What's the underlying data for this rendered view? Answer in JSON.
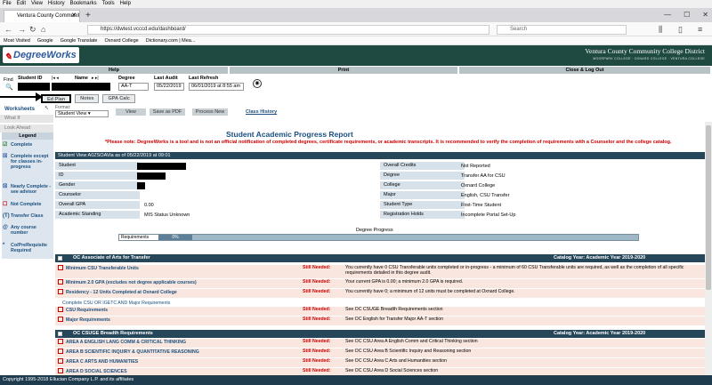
{
  "browser": {
    "menu": [
      "File",
      "Edit",
      "View",
      "History",
      "Bookmarks",
      "Tools",
      "Help"
    ],
    "tab_title": "Ventura County Community C",
    "url": "https://dwtest.vcccd.edu/dashboard/",
    "search_placeholder": "Search",
    "bookmarks": [
      "Most Visited",
      "Google",
      "Google Translate",
      "Oxnard College",
      "Dictionary.com | Mea..."
    ]
  },
  "header": {
    "logo": "DegreeWorks",
    "college": "Ventura County Community College District",
    "college_sub": "MOORPARK COLLEGE · OXNARD COLLEGE · VENTURA COLLEGE",
    "nav": [
      "Help",
      "Print",
      "Close & Log Out"
    ]
  },
  "student_bar": {
    "find": "Find",
    "student_id_lbl": "Student ID",
    "name_lbl": "Name",
    "degree_lbl": "Degree",
    "degree_val": "AA-T",
    "last_audit_lbl": "Last Audit",
    "last_audit_val": "05/22/2019",
    "last_refresh_lbl": "Last Refresh",
    "last_refresh_val": "06/01/2019 at 8:55 am"
  },
  "tabs": [
    "Ed Plan",
    "Notes",
    "GPA Calc"
  ],
  "worksheets": "Worksheets",
  "format_lbl": "Format:",
  "format_val": "Student View",
  "buttons": [
    "View",
    "Save as PDF",
    "Process New"
  ],
  "class_history": "Class History",
  "sidebar": {
    "what_if": "What If",
    "look_ahead": "Look Ahead",
    "legend_title": "Legend",
    "legend": [
      {
        "icon": "☑",
        "label": "Complete",
        "color": "#2a8a2a"
      },
      {
        "icon": "☒",
        "label": "Complete except for classes in-progress",
        "color": "#2c5aa0"
      },
      {
        "icon": "☒",
        "label": "Nearly Complete - see advisor",
        "color": "#2c5aa0"
      },
      {
        "icon": "☐",
        "label": "Not Complete",
        "color": "#c00"
      },
      {
        "icon": "(T)",
        "label": "Transfer Class",
        "color": "#1a4f7f"
      },
      {
        "icon": "@",
        "label": "Any course number",
        "color": "#1a4f7f"
      },
      {
        "icon": "*",
        "label": "Co/PreRequisite Required",
        "color": "#1a4f7f"
      }
    ]
  },
  "report": {
    "title": "Student Academic Progress Report",
    "notice": "*Please note: DegreeWorks is a tool and is not an official notification of completed degrees, certificate requirements, or academic transcripts. It is recommended to verify the completion of requirements with a Counselor and the college catalog.",
    "sv_bar": "Student View    A0ZSOAVia as of 05/22/2019 at 09:01",
    "info_left": [
      {
        "label": "Student",
        "value": ""
      },
      {
        "label": "ID",
        "value": ""
      },
      {
        "label": "Gender",
        "value": ""
      },
      {
        "label": "Counselor",
        "value": ""
      },
      {
        "label": "Overall GPA",
        "value": "0.00"
      },
      {
        "label": "Academic Standing",
        "value": "MIS Status Unknown"
      }
    ],
    "info_right": [
      {
        "label": "Overall Credits",
        "value": "Not Reported"
      },
      {
        "label": "Degree",
        "value": "Transfer AA for CSU"
      },
      {
        "label": "College",
        "value": "Oxnard College"
      },
      {
        "label": "Major",
        "value": "English, CSU Transfer"
      },
      {
        "label": "Student Type",
        "value": "First-Time Student"
      },
      {
        "label": "Registration Holds",
        "value": "Incomplete Portal Set-Up"
      }
    ],
    "degree_progress": "Degree Progress",
    "requirements_lbl": "Requirements",
    "requirements_pct": "0%",
    "sections": [
      {
        "title": "OC Associate of Arts for Transfer",
        "catalog": "Catalog Year:   Academic Year 2019-2020"
      },
      {
        "title": "OC CSUGE Breadth Requirements",
        "catalog": "Catalog Year:   Academic Year 2019-2020"
      }
    ],
    "still_needed": "Still Needed:",
    "reqs1": [
      {
        "name": "Minimum CSU Transferable Units",
        "desc": "You currently have 0 CSU Transferable units completed or in-progress - a minimum of 60 CSU Transferable units are required, as well as the completion of all specific requirements detailed in this degree audit."
      },
      {
        "name": "Minimum 2.0 GPA (excludes not degree applicable courses)",
        "desc": "Your current GPA is 0.00; a minimum 2.0 GPA is required."
      },
      {
        "name": "Residency - 12 Units Completed at Oxnard College",
        "desc": "You currently have 0; a minimum of 12 units must be completed at Oxnard College."
      }
    ],
    "sub_label": "Complete CSU OR IGETC AND Major Requirements",
    "reqs2": [
      {
        "name": "CSU Requirements",
        "desc": "See OC CSUGE Breadth Requirements section"
      },
      {
        "name": "Major Requirements",
        "desc": "See OC English for Transfer Major AA-T section"
      }
    ],
    "reqs3": [
      {
        "name": "AREA A ENGLISH LANG COMM & CRITICAL THINKING",
        "desc": "See OC CSU Area A English Comm and Critical Thinking section"
      },
      {
        "name": "AREA B SCIENTIFIC INQUIRY & QUANTITATIVE REASONING",
        "desc": "See OC CSU Area B Scientific Inquiry and Reasoning section"
      },
      {
        "name": "AREA C ARTS AND HUMANITIES",
        "desc": "See OC CSU Area C Arts and Humanities section"
      },
      {
        "name": "AREA D SOCIAL SCIENCES",
        "desc": "See OC CSU Area D Social Sciences section"
      }
    ]
  },
  "footer": "Copyright 1995-2018 Ellucian Company L.P. and its affiliates"
}
